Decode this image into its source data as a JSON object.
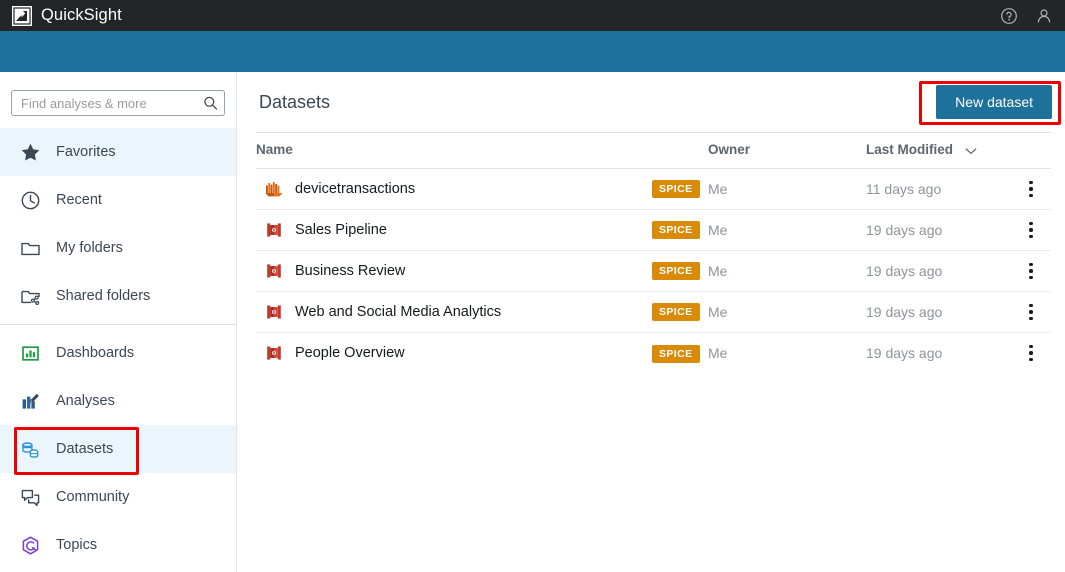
{
  "topbar": {
    "brand": "QuickSight",
    "logo_icon": "quicksight-logo-icon",
    "help_icon": "help-circle-icon",
    "account_icon": "user-account-icon"
  },
  "sidebar": {
    "search": {
      "placeholder": "Find analyses & more",
      "value": "",
      "icon": "search-icon"
    },
    "items": [
      {
        "label": "Favorites",
        "icon": "star-icon",
        "active": true
      },
      {
        "label": "Recent",
        "icon": "clock-icon",
        "active": false
      },
      {
        "label": "My folders",
        "icon": "folder-icon",
        "active": false
      },
      {
        "label": "Shared folders",
        "icon": "folder-share-icon",
        "active": false
      },
      {
        "label": "Dashboards",
        "icon": "dashboard-icon",
        "active": false
      },
      {
        "label": "Analyses",
        "icon": "analyses-icon",
        "active": false
      },
      {
        "label": "Datasets",
        "icon": "datasets-icon",
        "active": true
      },
      {
        "label": "Community",
        "icon": "community-icon",
        "active": false
      },
      {
        "label": "Topics",
        "icon": "topics-icon",
        "active": false
      }
    ]
  },
  "main": {
    "page_title": "Datasets",
    "new_dataset_label": "New dataset",
    "columns": {
      "name": "Name",
      "owner": "Owner",
      "last_modified": "Last Modified",
      "sort_icon": "chevron-down-icon"
    },
    "rows": [
      {
        "name": "devicetransactions",
        "icon": "redshift-dataset-icon",
        "badge": "SPICE",
        "owner": "Me",
        "last_modified": "11 days ago",
        "menu_icon": "kebab-menu-icon"
      },
      {
        "name": "Sales Pipeline",
        "icon": "file-dataset-icon",
        "badge": "SPICE",
        "owner": "Me",
        "last_modified": "19 days ago",
        "menu_icon": "kebab-menu-icon"
      },
      {
        "name": "Business Review",
        "icon": "file-dataset-icon",
        "badge": "SPICE",
        "owner": "Me",
        "last_modified": "19 days ago",
        "menu_icon": "kebab-menu-icon"
      },
      {
        "name": "Web and Social Media Analytics",
        "icon": "file-dataset-icon",
        "badge": "SPICE",
        "owner": "Me",
        "last_modified": "19 days ago",
        "menu_icon": "kebab-menu-icon"
      },
      {
        "name": "People Overview",
        "icon": "file-dataset-icon",
        "badge": "SPICE",
        "owner": "Me",
        "last_modified": "19 days ago",
        "menu_icon": "kebab-menu-icon"
      }
    ]
  },
  "colors": {
    "topbar": "#232526",
    "banner_teal": "#1d719a",
    "accent_button": "#1d719a",
    "active_nav": "#eaf6fc",
    "spice_badge": "#d98b08",
    "sort_column": "#d98b2b",
    "annotation": "#ee0000"
  }
}
